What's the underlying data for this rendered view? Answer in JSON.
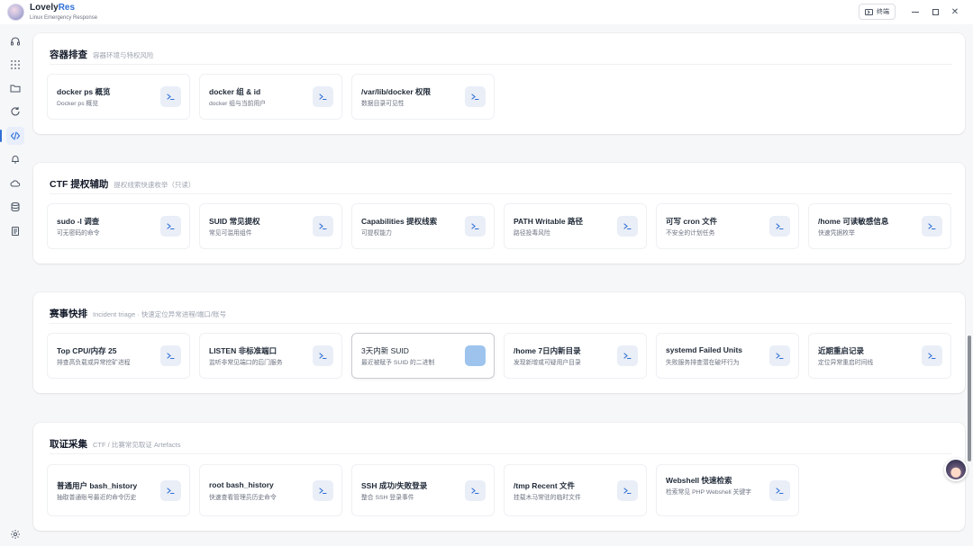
{
  "app": {
    "name_prefix": "Lovely",
    "name_accent": "Res",
    "subtitle": "Linux Emergency Response",
    "terminal_label": "终端"
  },
  "colors": {
    "accent": "#2f6fd6",
    "button_bg": "#e9eef7",
    "button_pressed": "#9ec4ee"
  },
  "sidebar": {
    "items": [
      {
        "icon": "headphones-icon"
      },
      {
        "icon": "grid-icon"
      },
      {
        "icon": "folder-icon"
      },
      {
        "icon": "refresh-icon"
      },
      {
        "icon": "code-icon",
        "active": true
      },
      {
        "icon": "bell-icon"
      },
      {
        "icon": "cloud-icon"
      },
      {
        "icon": "database-icon"
      },
      {
        "icon": "document-icon"
      }
    ],
    "bottom": {
      "icon": "gear-icon"
    }
  },
  "sections": [
    {
      "title": "容器排查",
      "subtitle": "容器环境与特权风险",
      "cards": [
        {
          "title": "docker ps 概览",
          "desc": "Docker ps 概览"
        },
        {
          "title": "docker 组 & id",
          "desc": "docker 组与当前用户"
        },
        {
          "title": "/var/lib/docker 权限",
          "desc": "数据目录可见性"
        }
      ]
    },
    {
      "title": "CTF 提权辅助",
      "subtitle": "提权线索快速枚举（只读）",
      "cards": [
        {
          "title": "sudo -l 调查",
          "desc": "可无密码的命令"
        },
        {
          "title": "SUID 常见提权",
          "desc": "常见可滥用组件"
        },
        {
          "title": "Capabilities 提权线索",
          "desc": "可提权能力"
        },
        {
          "title": "PATH Writable 路径",
          "desc": "路径投毒风险"
        },
        {
          "title": "可写 cron 文件",
          "desc": "不安全的计划任务"
        },
        {
          "title": "/home 可读敏感信息",
          "desc": "快速凭据枚举"
        }
      ]
    },
    {
      "title": "赛事快排",
      "subtitle": "Incident triage · 快速定位异常进程/端口/账号",
      "cards": [
        {
          "title": "Top CPU/内存 25",
          "desc": "排查高负载或异常挖矿进程"
        },
        {
          "title": "LISTEN 非标准端口",
          "desc": "监听非常见端口的后门服务"
        },
        {
          "title": "3天内新 SUID",
          "desc": "最近被赋予 SUID 的二进制",
          "highlight": true
        },
        {
          "title": "/home 7日内新目录",
          "desc": "发现新增或可疑用户目录"
        },
        {
          "title": "systemd Failed Units",
          "desc": "失败服务排查潜在破坏行为"
        },
        {
          "title": "近期重启记录",
          "desc": "定位异常重启时间线"
        }
      ]
    },
    {
      "title": "取证采集",
      "subtitle": "CTF / 比赛常见取证 Artefacts",
      "cards": [
        {
          "title": "普通用户 bash_history",
          "desc": "抽取普通账号最近的命令历史"
        },
        {
          "title": "root bash_history",
          "desc": "快速查看管理员历史命令"
        },
        {
          "title": "SSH 成功/失败登录",
          "desc": "整合 SSH 登录事件"
        },
        {
          "title": "/tmp Recent 文件",
          "desc": "挂载木马常驻的临时文件"
        },
        {
          "title": "Webshell 快速检索",
          "desc": "检索常见 PHP Webshell 关键字"
        }
      ]
    }
  ]
}
